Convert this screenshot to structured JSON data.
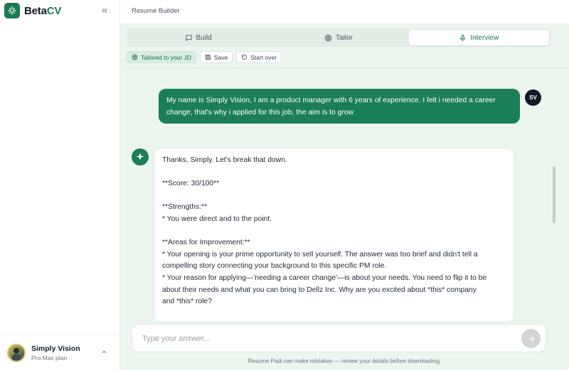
{
  "brand": {
    "name_part1": "Beta",
    "name_part2": "CV",
    "accent_color": "#1a7a52"
  },
  "header": {
    "title": "Resume Builder"
  },
  "tabs": [
    {
      "label": "Build",
      "icon": "chat-bubble-icon",
      "active": false
    },
    {
      "label": "Tailor",
      "icon": "target-icon",
      "active": false
    },
    {
      "label": "Interview",
      "icon": "microphone-icon",
      "active": true
    }
  ],
  "actions": {
    "badge_label": "Tailored to your JD",
    "save_label": "Save",
    "start_over_label": "Start over"
  },
  "chat": {
    "user_initials": "SV",
    "user_message": "My name is Simply Vision, I am a product manager with 6 years of experience. I felt i needed a career change, that's why i applied for this job, the aim is to grow",
    "bot_lines": [
      "Thanks, Simply. Let's break that down.",
      "",
      "**Score: 30/100**",
      "",
      "**Strengths:**",
      "* You were direct and to the point.",
      "",
      "**Areas for Improvement:**",
      "* Your opening is your prime opportunity to sell yourself. The answer was too brief and didn't tell a",
      "compelling story connecting your background to this specific PM role.",
      "* Your reason for applying—'needing a career change'—is about your needs. You need to flip it to be",
      "about their needs and what you can bring to Dellz Inc. Why are you excited about *this* company",
      "and *this* role?"
    ]
  },
  "composer": {
    "placeholder": "Type your answer...",
    "disclaimer": "Resume Padi can make mistakes — review your details before downloading."
  },
  "user": {
    "name": "Simply Vision",
    "plan": "Pro Max plan"
  }
}
